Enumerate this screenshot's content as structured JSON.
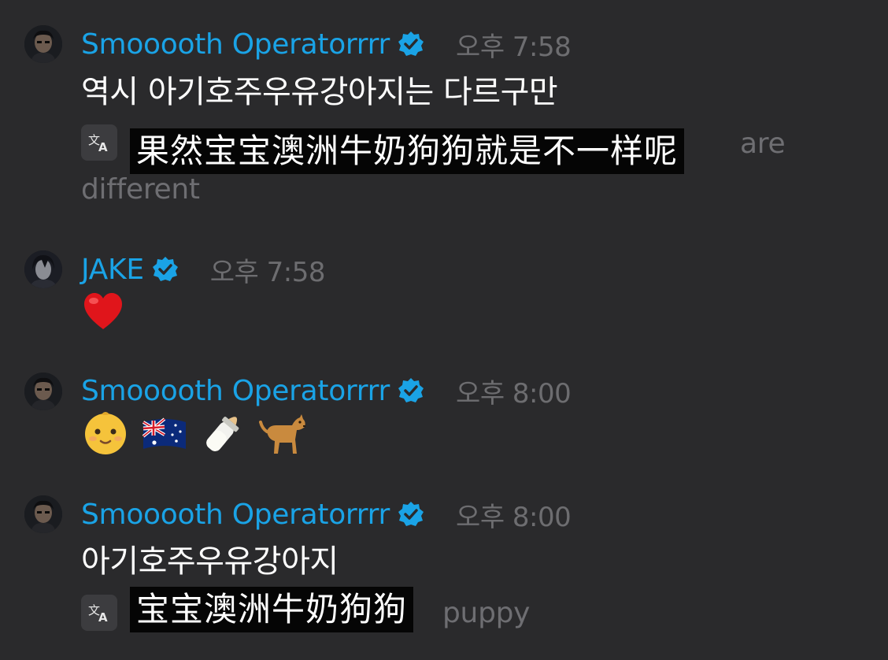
{
  "messages": [
    {
      "author": "Smooooth Operatorrrr",
      "time": "오후 7:58",
      "text": "역시 아기호주우유강아지는 다르구만",
      "translation_visible_end": "are",
      "translation_second_line": "different",
      "subtitle": "果然宝宝澳洲牛奶狗狗就是不一样呢",
      "translate_icon": "translate-icon"
    },
    {
      "author": "JAKE",
      "time": "오후 7:58",
      "reaction": "heart-emoji"
    },
    {
      "author": "Smooooth Operatorrrr",
      "time": "오후 8:00",
      "emojis": [
        "baby-emoji",
        "australia-flag-emoji",
        "baby-bottle-emoji",
        "dog-emoji"
      ]
    },
    {
      "author": "Smooooth Operatorrrr",
      "time": "오후 8:00",
      "text": "아기호주우유강아지",
      "translation_visible_end": "puppy",
      "subtitle": "宝宝澳洲牛奶狗狗",
      "translate_icon": "translate-icon"
    }
  ],
  "colors": {
    "background": "#2a2a2c",
    "username": "#1aa3e6",
    "verified_badge": "#1aa3e6",
    "timestamp": "#6d6d70",
    "translation_text": "#6e6e72",
    "subtitle_bg": "#050505"
  }
}
